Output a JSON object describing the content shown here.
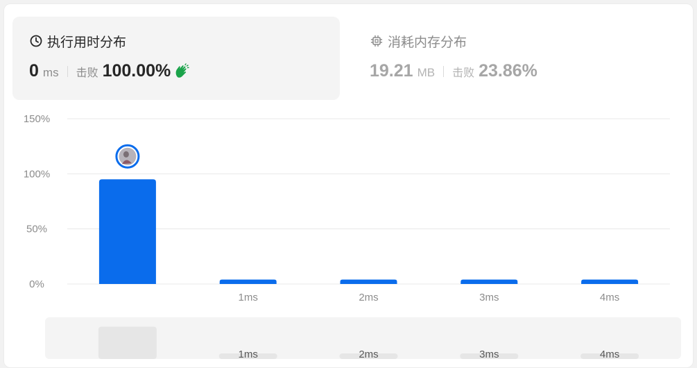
{
  "runtime_panel": {
    "title": "执行用时分布",
    "value": "0",
    "unit": "ms",
    "beats_label": "击败",
    "beats_value": "100.00%",
    "icon": "clock-icon",
    "accent_icon": "clap-icon"
  },
  "memory_panel": {
    "title": "消耗内存分布",
    "value": "19.21",
    "unit": "MB",
    "beats_label": "击败",
    "beats_value": "23.86%",
    "icon": "chip-icon"
  },
  "colors": {
    "bar": "#0a6cec",
    "grid": "#e8e8e8",
    "axis_text": "#8c8c8c",
    "clap": "#1aa34a",
    "overview_bar": "#e6e6e6"
  },
  "chart_data": {
    "type": "bar",
    "categories": [
      "",
      "1ms",
      "2ms",
      "3ms",
      "4ms"
    ],
    "values": [
      95,
      4,
      4,
      4,
      4
    ],
    "y_ticks": [
      "0%",
      "50%",
      "100%",
      "150%"
    ],
    "ylim": [
      0,
      150
    ],
    "grid": true,
    "marker": {
      "category_index": 0,
      "icon": "avatar"
    }
  },
  "overview": {
    "categories": [
      "",
      "1ms",
      "2ms",
      "3ms",
      "4ms"
    ],
    "values": [
      95,
      4,
      4,
      4,
      4
    ]
  }
}
